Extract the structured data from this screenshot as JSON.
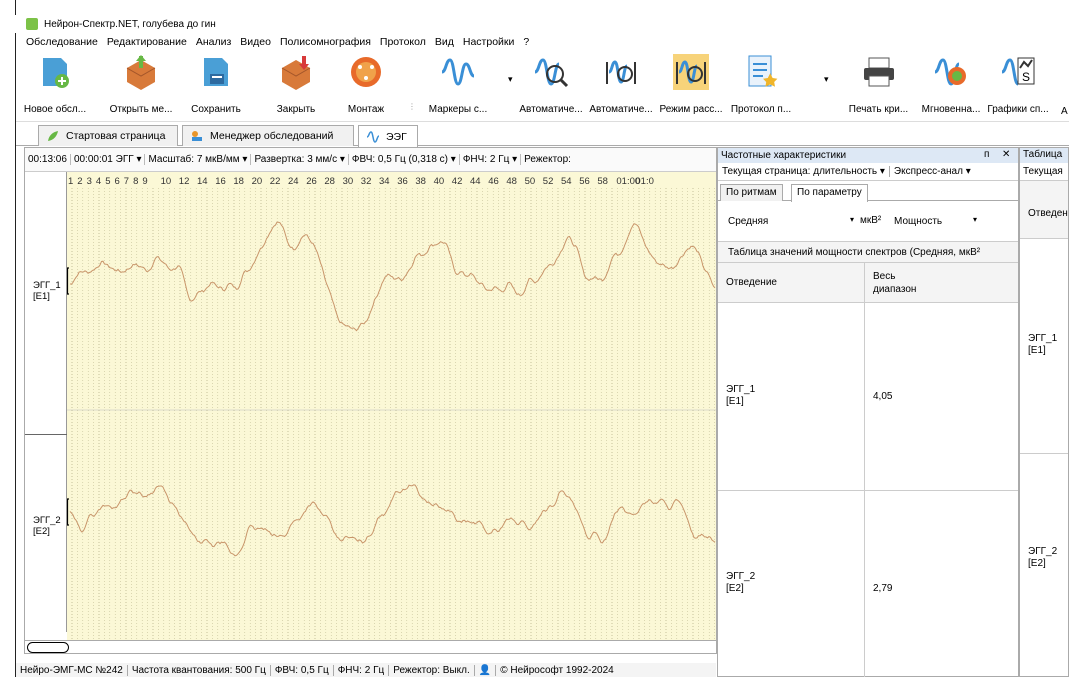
{
  "window": {
    "title": "Нейрон-Спектр.NET, голубева до гин"
  },
  "menu": [
    "Обследование",
    "Редактирование",
    "Анализ",
    "Видео",
    "Полисомнография",
    "Протокол",
    "Вид",
    "Настройки",
    "?"
  ],
  "toolbar": [
    {
      "label": "Новое обсл...",
      "icon": "new-exam-icon"
    },
    {
      "label": "Открыть ме...",
      "icon": "open-icon"
    },
    {
      "label": "Сохранить",
      "icon": "save-icon"
    },
    {
      "label": "Закрыть",
      "icon": "close-exam-icon"
    },
    {
      "label": "Монтаж",
      "icon": "montage-icon"
    },
    {
      "label": "Маркеры с...",
      "icon": "markers-icon"
    },
    {
      "label": "Автоматиче...",
      "icon": "auto-analysis-icon"
    },
    {
      "label": "Автоматиче...",
      "icon": "auto-analysis2-icon"
    },
    {
      "label": "Режим расс...",
      "icon": "review-mode-icon"
    },
    {
      "label": "Протокол п...",
      "icon": "protocol-icon"
    },
    {
      "label": "Печать кри...",
      "icon": "print-icon"
    },
    {
      "label": "Мгновенна...",
      "icon": "instant-spectrum-icon"
    },
    {
      "label": "Графики сп...",
      "icon": "spectrum-graphs-icon"
    },
    {
      "label": "А",
      "icon": ""
    }
  ],
  "tabs": [
    {
      "label": "Стартовая страница",
      "icon": "home-leaf-icon"
    },
    {
      "label": "Менеджер обследований",
      "icon": "exam-manager-icon"
    },
    {
      "label": "ЭЭГ",
      "icon": "eeg-icon"
    }
  ],
  "eeg_toolbar": {
    "time": "00:13:06",
    "duration": "00:00:01 ЭГГ",
    "scale": "Масштаб: 7 мкВ/мм",
    "sweep": "Развертка: 3 мм/с",
    "hpf": "ФВЧ: 0,5 Гц (0,318 с)",
    "lpf": "ФНЧ: 2 Гц",
    "notch": "Режектор:"
  },
  "time_ruler": [
    "1",
    "2",
    "3",
    "4",
    "5",
    "6",
    "7",
    "8",
    "9",
    "10",
    "12",
    "14",
    "16",
    "18",
    "20",
    "22",
    "24",
    "26",
    "28",
    "30",
    "32",
    "34",
    "36",
    "38",
    "40",
    "42",
    "44",
    "46",
    "48",
    "50",
    "52",
    "54",
    "56",
    "58",
    "01:00",
    "01:0"
  ],
  "channels": [
    {
      "name": "ЭГГ_1",
      "sub": "[E1]"
    },
    {
      "name": "ЭГГ_2",
      "sub": "[E2]"
    }
  ],
  "status": [
    "Нейро-ЭМГ-МС №242",
    "Частота квантования: 500 Гц",
    "ФВЧ: 0,5 Гц",
    "ФНЧ: 2 Гц",
    "Режектор: Выкл.",
    "© Нейрософт 1992-2024"
  ],
  "freq_panel": {
    "title": "Частотные характеристики",
    "pin": "ᴨ",
    "close": "✕",
    "current_page": "Текущая страница: длительность",
    "express": "Экспресс-анал",
    "tab_rhythms": "По ритмам",
    "tab_param": "По параметру",
    "agg": "Средняя",
    "unit": "мкВ²",
    "param": "Мощность",
    "table_title": "Таблица значений мощности спектров (Средняя, мкВ²",
    "col_lead": "Отведение",
    "col_range": "Весь диапазон",
    "rows": [
      {
        "name": "ЭГГ_1",
        "sub": "[E1]",
        "value": "4,05"
      },
      {
        "name": "ЭГГ_2",
        "sub": "[E2]",
        "value": "2,79"
      }
    ]
  },
  "table_panel2": {
    "title": "Таблица",
    "current": "Текущая",
    "col": "Отведен",
    "rows": [
      {
        "name": "ЭГГ_1",
        "sub": "[E1]"
      },
      {
        "name": "ЭГГ_2",
        "sub": "[E2]"
      }
    ]
  },
  "colors": {
    "trace": "#c8956a",
    "plot_bg": "#fbf8d6",
    "grid": "#b8b48a"
  }
}
